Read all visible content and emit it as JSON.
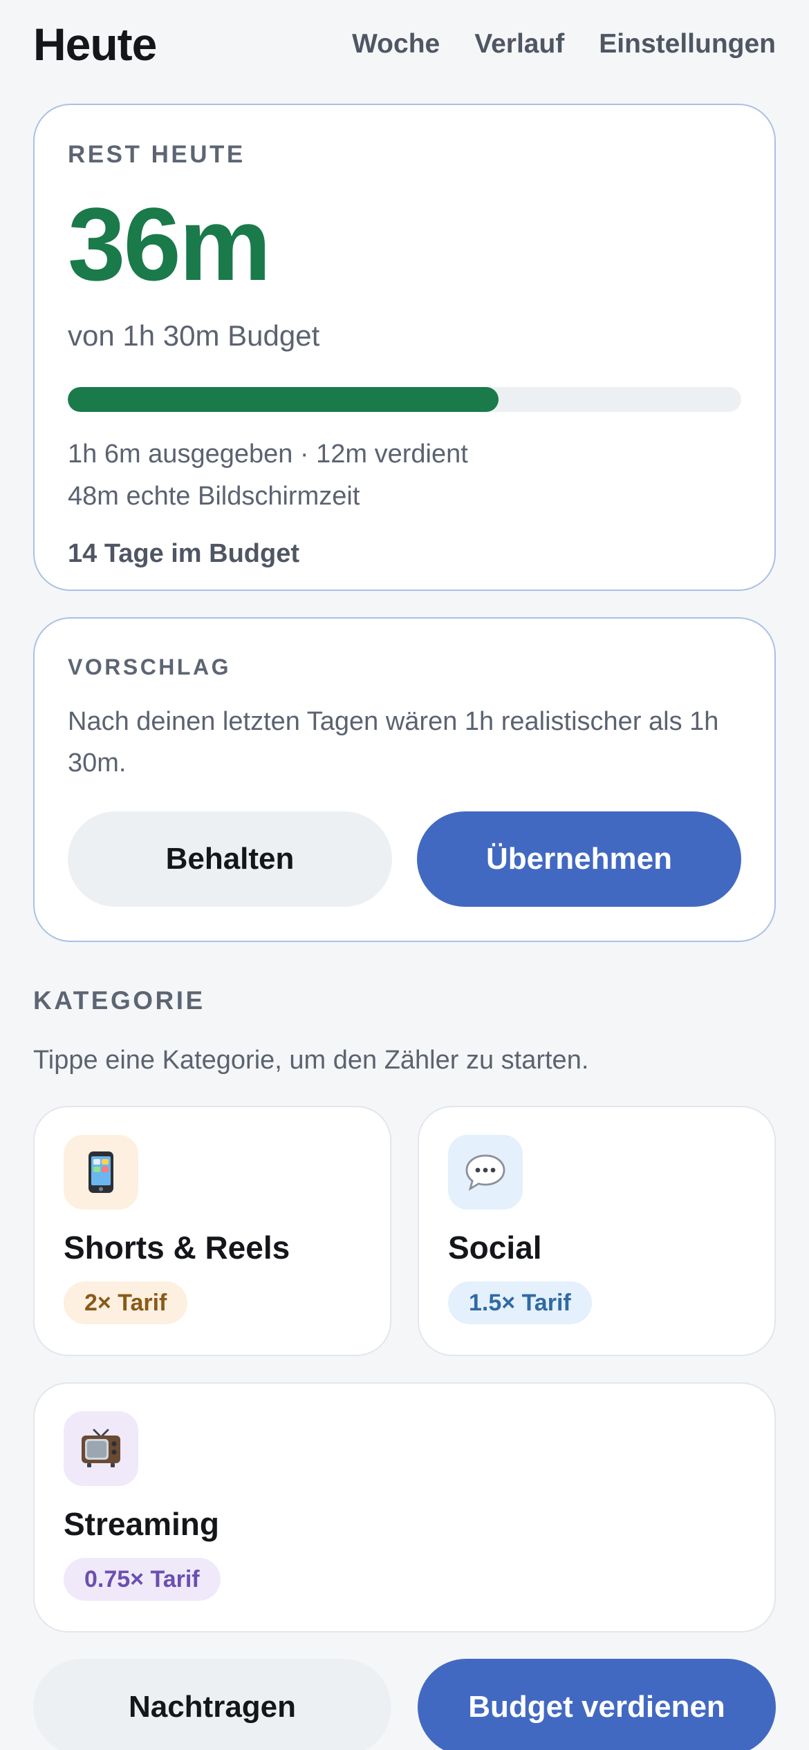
{
  "header": {
    "title": "Heute",
    "nav": [
      "Woche",
      "Verlauf",
      "Einstellungen"
    ]
  },
  "remaining": {
    "eyebrow": "REST HEUTE",
    "value": "36m",
    "budget_line": "von 1h 30m Budget",
    "progress_fraction": 0.64,
    "stat_spent": "1h 6m ausgegeben · 12m verdient",
    "stat_screen": "48m echte Bildschirmzeit",
    "streak": "14 Tage im Budget",
    "accent_color": "#1a7a4a"
  },
  "suggestion": {
    "eyebrow": "VORSCHLAG",
    "text": "Nach deinen letzten Tagen wären 1h realistischer als 1h 30m.",
    "keep_label": "Behalten",
    "accept_label": "Übernehmen"
  },
  "categories": {
    "title": "KATEGORIE",
    "hint": "Tippe eine Kategorie, um den Zähler zu starten.",
    "items": [
      {
        "name": "Shorts & Reels",
        "badge": "2× Tarif",
        "icon": "mobile-phone-icon",
        "icon_bg": "#fdf0e0",
        "badge_bg": "#fdf0e0",
        "badge_color": "#8a5a1a"
      },
      {
        "name": "Social",
        "badge": "1.5× Tarif",
        "icon": "speech-bubble-icon",
        "icon_bg": "#e4f0fc",
        "badge_bg": "#e4f0fc",
        "badge_color": "#2f6aa3"
      },
      {
        "name": "Streaming",
        "badge": "0.75× Tarif",
        "icon": "television-icon",
        "icon_bg": "#efe9fa",
        "badge_bg": "#efe9fa",
        "badge_color": "#6a4fb0"
      }
    ]
  },
  "actions": {
    "backfill_label": "Nachtragen",
    "earn_label": "Budget verdienen"
  },
  "colors": {
    "primary": "#4269c2",
    "secondary_bg": "#edf0f3",
    "card_border": "#aac0e6",
    "page_bg": "#f5f6f8"
  }
}
